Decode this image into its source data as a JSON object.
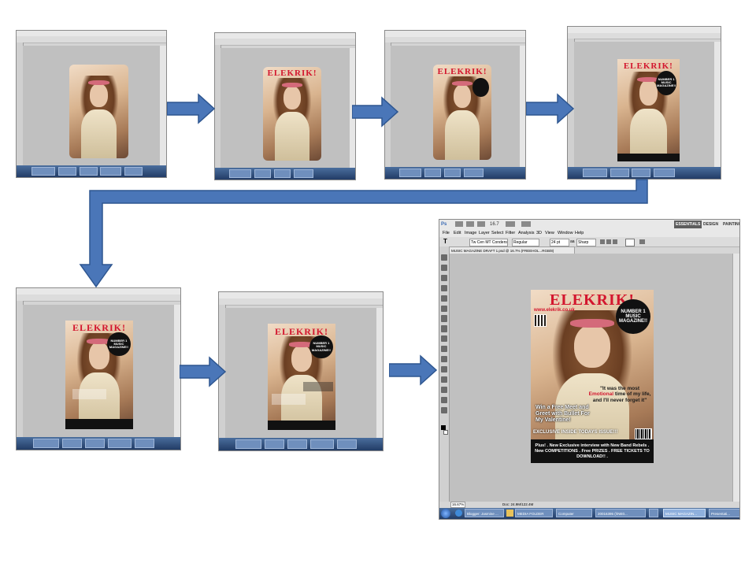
{
  "colors": {
    "arrow": "#4a76b8",
    "masthead": "#d3162e",
    "canvas": "#c0c0c0",
    "taskbar": "#2f4d7a"
  },
  "small_mast": "ELEKRIK!",
  "small_number1": "NUMBER 1 MUSIC MAGAZINE!!",
  "large": {
    "menu": [
      "Ps",
      "File",
      "Edit",
      "Image",
      "Layer",
      "Select",
      "Filter",
      "Analysis",
      "3D",
      "View",
      "Window",
      "Help"
    ],
    "zoom_small": "16.7",
    "workspaces": [
      "ESSENTIALS",
      "DESIGN",
      "PAINTING"
    ],
    "options": {
      "font": "Tw Cen MT Condense...",
      "style": "Regular",
      "size": "24 pt",
      "aa_label": "aa",
      "aa": "Sharp"
    },
    "doc_tab": "MUSIC MAGAZINE DRAFT 1.psd @ 16.7% (FREEHOL...RGB/8)",
    "cover": {
      "masthead": "ELEKRIK!",
      "url": "www.elekrik.co.uk",
      "circle": "NUMBER 1 MUSIC MAGAZINE!!",
      "quote_a": "\"It was the most ",
      "quote_emph": "Emotional",
      "quote_b": " time of my life, and I'll never forget it\"",
      "win": "Win a Free Meet and Greet with Bullet For My Valentine!",
      "exclusive": "EXCLUSIVE INSIDE TODAYS ISSUE!!!",
      "footer": "Plus! . New Exclusive interview with New Band Rebels . New COMPETITIONS . Free PRIZES . FREE TICKETS TO DOWNLOAD!! ."
    },
    "status": {
      "zoom": "16.67%",
      "doc": "Doc: 24.9M/122.4M"
    },
    "taskbar": [
      {
        "label": "Blogger: Jasmine ..."
      },
      {
        "label": "MEDIA FOLDER"
      },
      {
        "label": "Computer"
      },
      {
        "label": "20016395 (\\\\NE0..."
      },
      {
        "label": ""
      },
      {
        "label": "MUSIC MAGAZIN..."
      },
      {
        "label": "Presentati..."
      }
    ]
  }
}
